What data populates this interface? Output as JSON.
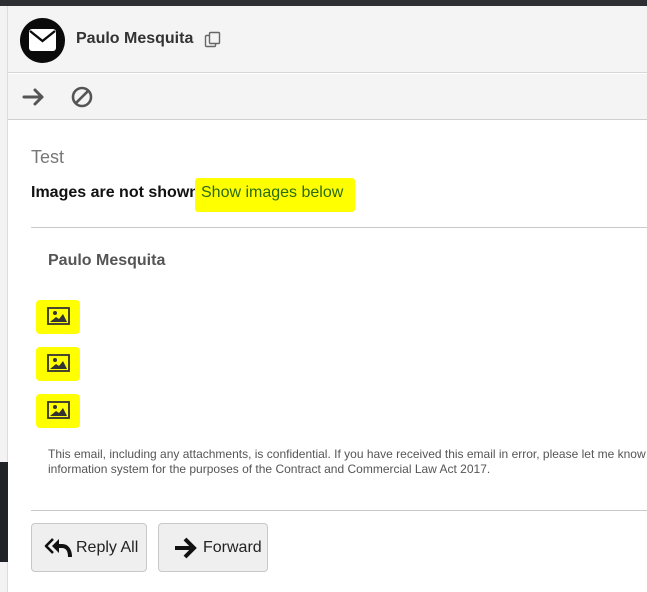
{
  "header": {
    "sender_name": "Paulo Mesquita",
    "avatar_icon": "envelope-icon",
    "copy_icon": "copy-icon"
  },
  "toolbar": {
    "forward_icon": "arrow-right-icon",
    "block_icon": "block-icon"
  },
  "message": {
    "subject": "Test",
    "images_notice": "Images are not shown.",
    "show_images_link": "Show images below",
    "body_sender": "Paulo Mesquita",
    "image_placeholders": [
      "image-icon",
      "image-icon",
      "image-icon"
    ],
    "disclaimer_line1": "This email, including any attachments, is confidential. If you have received this email in error, please let me know",
    "disclaimer_line2": "information system for the purposes of the Contract and Commercial Law Act 2017."
  },
  "actions": {
    "reply_all_label": "Reply All",
    "forward_label": "Forward"
  },
  "colors": {
    "highlight": "#ffff00",
    "link": "#2b6a16",
    "header_bg": "#f4f4f4"
  }
}
